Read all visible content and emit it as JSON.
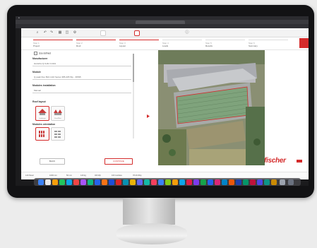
{
  "browser": {
    "tab_title": "",
    "menubar_text": ""
  },
  "toolbar": {
    "chip1": "",
    "chip2": ""
  },
  "steps": [
    {
      "num": "Step 1",
      "label": "Project"
    },
    {
      "num": "Step 2",
      "label": "Roof"
    },
    {
      "num": "Step 3",
      "label": "Layout"
    },
    {
      "num": "Step 4",
      "label": "Loads"
    },
    {
      "num": "Step 5",
      "label": "Results"
    },
    {
      "num": "Step 6",
      "label": "Summary"
    }
  ],
  "panel": {
    "checkbox_label": "Use defined",
    "manufacturer_title": "Manufacturer",
    "manufacturer_value": "Hanwha Q.Cells GmbH",
    "module_title": "Module",
    "module_value": "Q.peak Duo BLK-G10 Series 385-405 Wp - 36535",
    "installation_title": "Modules installation",
    "installation_value": "Manual",
    "roof_layout_title": "Roof layout",
    "roof_opt1": "Landscape",
    "roof_opt2": "East-West",
    "orientation_title": "Modules orientation",
    "back_label": "BACK",
    "continue_label": "CONTINUE"
  },
  "status": {
    "items": [
      "120 Panel",
      "1000 mm",
      "50 mm",
      "120 kg",
      "400 Wp",
      "100 modules",
      "78.40 kWp"
    ]
  },
  "brand": {
    "logo_text": "fischer",
    "accent": "#d42b2b"
  }
}
